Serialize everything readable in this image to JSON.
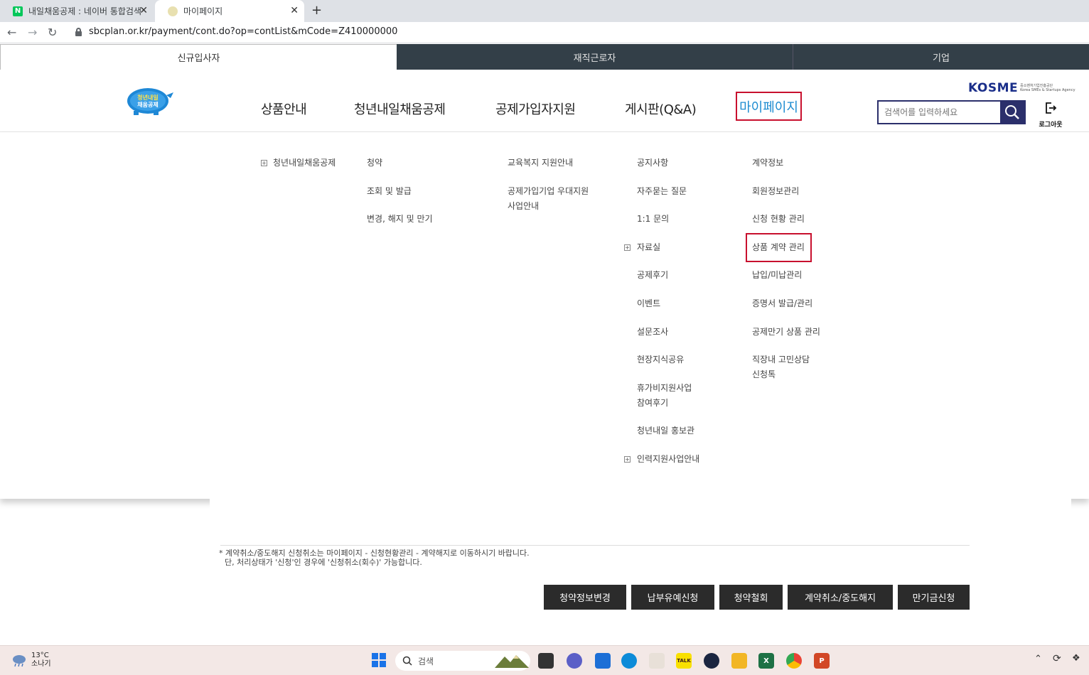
{
  "browser": {
    "tabs": [
      {
        "title": "내일채움공제 : 네이버 통합검색",
        "favicon": "N",
        "active": false
      },
      {
        "title": "마이페이지",
        "favicon": "",
        "active": true
      }
    ],
    "url": "sbcplan.or.kr/payment/cont.do?op=contList&mCode=Z410000000"
  },
  "site_tabs": [
    "신규입사자",
    "재직근로자",
    "기업"
  ],
  "header": {
    "logo_text_1": "청년내일",
    "logo_text_2": "채움공제",
    "nav": [
      "상품안내",
      "청년내일채움공제",
      "공제가입자지원",
      "게시판(Q&A)",
      "마이페이지"
    ],
    "kosme_word": "KOSME",
    "kosme_sub_1": "중소벤처기업진흥공단",
    "kosme_sub_2": "Korea SMEs & Startups Agency",
    "search_placeholder": "검색어를 입력하세요",
    "logout_label": "로그아웃"
  },
  "mega_menu": {
    "col1": [
      "청년내일채움공제"
    ],
    "col2": [
      "청약",
      "조회 및 발급",
      "변경, 해지 및 만기"
    ],
    "col3": [
      "교육복지 지원안내",
      "공제가입기업 우대지원",
      "사업안내"
    ],
    "col4": [
      "공지사항",
      "자주묻는 질문",
      "1:1 문의",
      "자료실",
      "공제후기",
      "이벤트",
      "설문조사",
      "현장지식공유",
      "휴가비지원사업",
      "참여후기",
      "청년내일 홍보관",
      "인력지원사업안내"
    ],
    "col5": [
      "계약정보",
      "회원정보관리",
      "신청 현황 관리",
      "상품 계약 관리",
      "납입/미납관리",
      "증명서 발급/관리",
      "공제만기 상품 관리",
      "직장내 고민상담",
      "신청톡"
    ]
  },
  "notice": {
    "line1": "* 계약취소/중도해지 신청취소는 마이페이지 - 신청현황관리 - 계약해지로 이동하시기 바랍니다.",
    "line2": "단, 처리상태가 '신청'인 경우에 '신청취소(회수)' 가능합니다."
  },
  "actions": [
    "청약정보변경",
    "납부유예신청",
    "청약철회",
    "계약취소/중도해지",
    "만기금신청"
  ],
  "taskbar": {
    "temp": "13°C",
    "weather": "소나기",
    "search_label": "검색"
  },
  "colors": {
    "dark_tab": "#333f48",
    "highlight": "#c8102e",
    "active_link": "#1c8bd0",
    "button_bg": "#2b2b2b",
    "kosme": "#1b2f8a"
  }
}
